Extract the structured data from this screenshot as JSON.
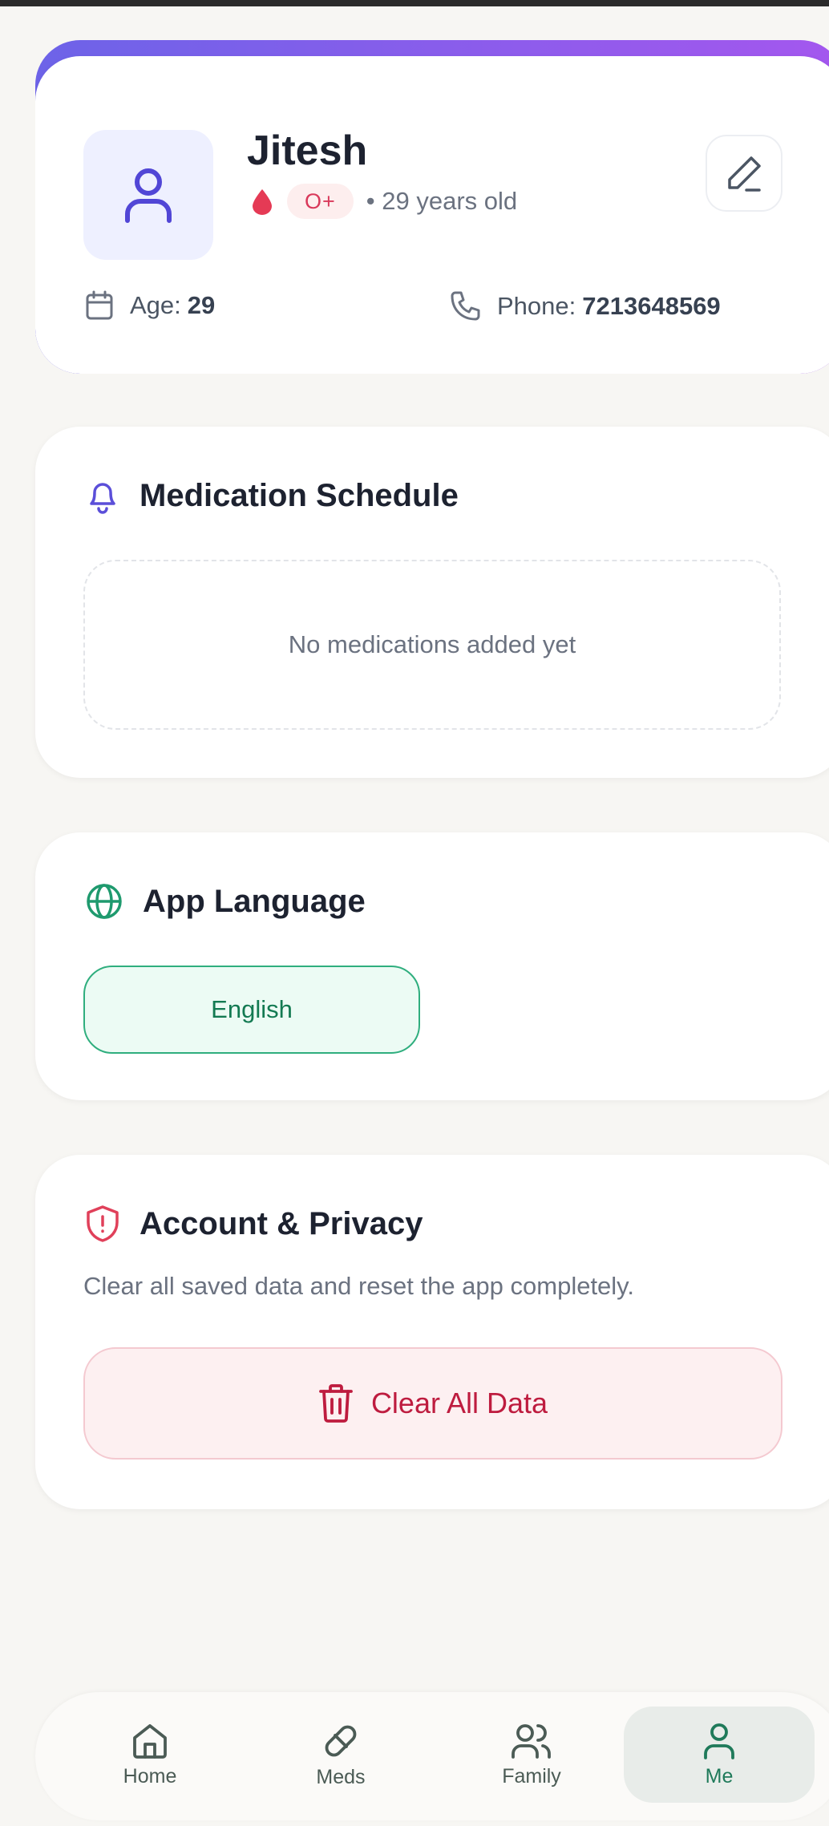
{
  "profile": {
    "name": "Jitesh",
    "blood_group": "O+",
    "age_text": "• 29 years old",
    "age_label": "Age:",
    "age_value": "29",
    "phone_label": "Phone:",
    "phone_value": "7213648569"
  },
  "medication": {
    "title": "Medication Schedule",
    "empty_text": "No medications added yet"
  },
  "language": {
    "title": "App Language",
    "selected": "English"
  },
  "privacy": {
    "title": "Account & Privacy",
    "description": "Clear all saved data and reset the app completely.",
    "clear_label": "Clear All Data"
  },
  "nav": {
    "items": [
      {
        "label": "Home",
        "icon": "home-icon"
      },
      {
        "label": "Meds",
        "icon": "pill-icon"
      },
      {
        "label": "Family",
        "icon": "users-icon"
      },
      {
        "label": "Me",
        "icon": "user-icon"
      }
    ],
    "active": "Me"
  },
  "colors": {
    "accent_indigo": "#5b4fd9",
    "accent_green": "#1f9a6e",
    "danger": "#be1c3f",
    "gradient_start": "#6d63e8",
    "gradient_end": "#a457ee"
  }
}
